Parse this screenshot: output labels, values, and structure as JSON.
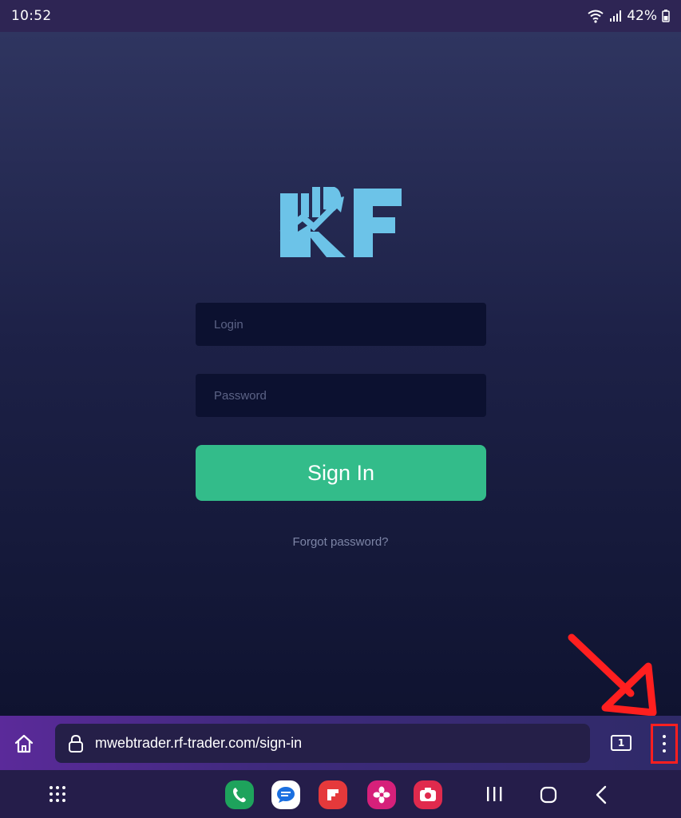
{
  "status_bar": {
    "time": "10:52",
    "battery": "42%",
    "icons": [
      "wifi-icon",
      "signal-icon",
      "battery-icon"
    ]
  },
  "page": {
    "logo_text": "RF",
    "login_placeholder": "Login",
    "password_placeholder": "Password",
    "signin_label": "Sign In",
    "forgot_label": "Forgot password?"
  },
  "browser": {
    "url": "mwebtrader.rf-trader.com/sign-in",
    "tab_count": "1",
    "icons": [
      "home-icon",
      "lock-icon",
      "tabs-icon",
      "more-options-icon"
    ]
  },
  "nav_bar": {
    "apps": [
      "phone-app-icon",
      "messages-app-icon",
      "flipboard-app-icon",
      "gallery-app-icon",
      "camera-app-icon"
    ],
    "icons": [
      "app-drawer-icon",
      "recents-icon",
      "home-nav-icon",
      "back-icon"
    ]
  },
  "colors": {
    "accent_green": "#33bc8a",
    "logo_blue": "#6cc3e8",
    "annotation_red": "#ff1f1f"
  }
}
